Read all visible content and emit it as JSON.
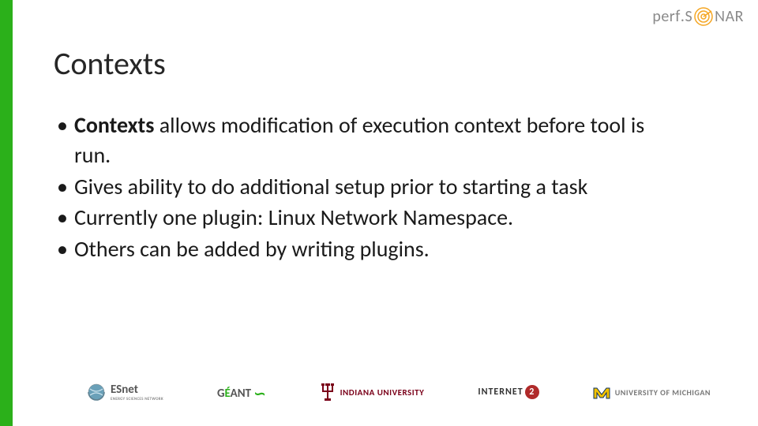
{
  "logo": {
    "prefix": "perf",
    "suffix": "NAR",
    "full": "perfSONAR"
  },
  "title": "Contexts",
  "bullets": [
    {
      "bold_lead": "Contexts",
      "text": " allows modification of execution context before tool is run."
    },
    {
      "bold_lead": "",
      "text": "Gives ability to do additional setup prior to starting a task"
    },
    {
      "bold_lead": "",
      "text": "Currently one plugin: Linux Network Namespace."
    },
    {
      "bold_lead": "",
      "text": "Others can be added by writing plugins."
    }
  ],
  "footer": {
    "esnet": {
      "name": "ESnet",
      "subtitle": "ENERGY SCIENCES NETWORK"
    },
    "geant": {
      "prefix": "G",
      "accent": "É",
      "suffix": "ANT"
    },
    "iu": "INDIANA UNIVERSITY",
    "internet2": {
      "pre": "INTERNET",
      "num": "2"
    },
    "umich": "UNIVERSITY OF MICHIGAN"
  }
}
